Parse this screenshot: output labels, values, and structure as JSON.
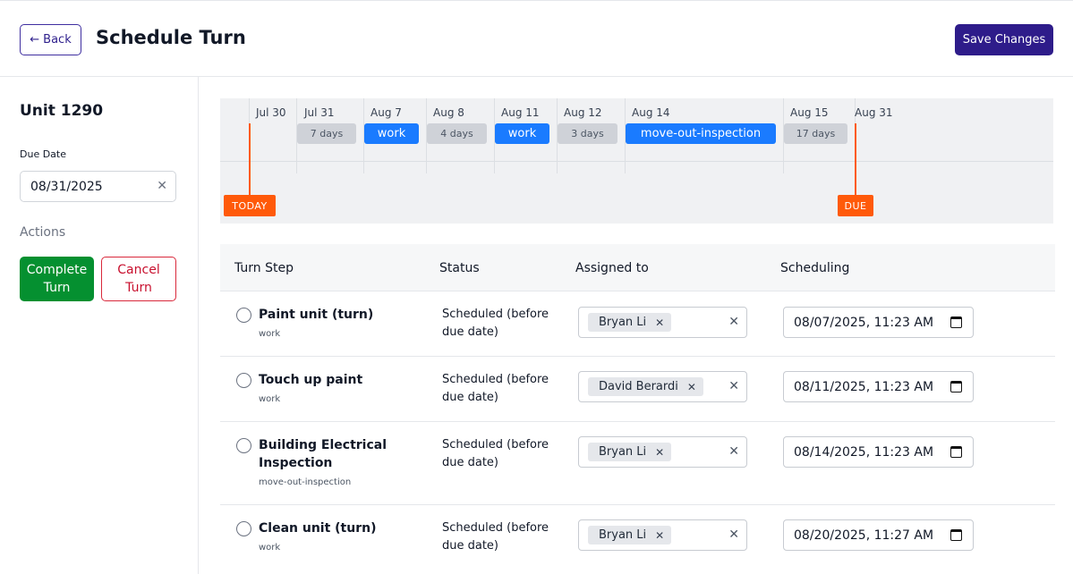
{
  "header": {
    "back_label": "Back",
    "back_icon": "arrow-left-icon",
    "title": "Schedule Turn",
    "save_label": "Save Changes"
  },
  "sidebar": {
    "unit_title": "Unit 1290",
    "due_date_label": "Due Date",
    "due_date_value": "08/31/2025",
    "clear_icon": "close-icon",
    "actions_label": "Actions",
    "complete_label": "Complete Turn",
    "cancel_label": "Cancel Turn"
  },
  "timeline": {
    "dates": [
      "Jul 30",
      "Jul 31",
      "Aug 7",
      "Aug 8",
      "Aug 11",
      "Aug 12",
      "Aug 14",
      "Aug 15",
      "Aug 31"
    ],
    "bars": [
      {
        "label": "7 days",
        "kind": "gap"
      },
      {
        "label": "work",
        "kind": "task"
      },
      {
        "label": "4 days",
        "kind": "gap"
      },
      {
        "label": "work",
        "kind": "task"
      },
      {
        "label": "3 days",
        "kind": "gap"
      },
      {
        "label": "move-out-inspection",
        "kind": "task"
      },
      {
        "label": "17 days",
        "kind": "gap"
      }
    ],
    "today_label": "TODAY",
    "due_label": "DUE",
    "colors": {
      "task": "#1a7bff",
      "gap": "#cfd2d8",
      "marker": "#ff5a0a"
    }
  },
  "table": {
    "headers": [
      "Turn Step",
      "Status",
      "Assigned to",
      "Scheduling"
    ],
    "rows": [
      {
        "name": "Paint unit (turn)",
        "type": "work",
        "status": "Scheduled (before due date)",
        "assignee": "Bryan Li",
        "schedule": "08/07/2025, 11:23 AM"
      },
      {
        "name": "Touch up paint",
        "type": "work",
        "status": "Scheduled (before due date)",
        "assignee": "David Berardi",
        "schedule": "08/11/2025, 11:23 AM"
      },
      {
        "name": "Building Electrical Inspection",
        "type": "move-out-inspection",
        "status": "Scheduled (before due date)",
        "assignee": "Bryan Li",
        "schedule": "08/14/2025, 11:23 AM"
      },
      {
        "name": "Clean unit (turn)",
        "type": "work",
        "status": "Scheduled (before due date)",
        "assignee": "Bryan Li",
        "schedule": "08/20/2025, 11:27 AM"
      }
    ]
  },
  "colors": {
    "primary": "#2e1c8a",
    "complete": "#059030",
    "cancel": "#c8102e"
  }
}
